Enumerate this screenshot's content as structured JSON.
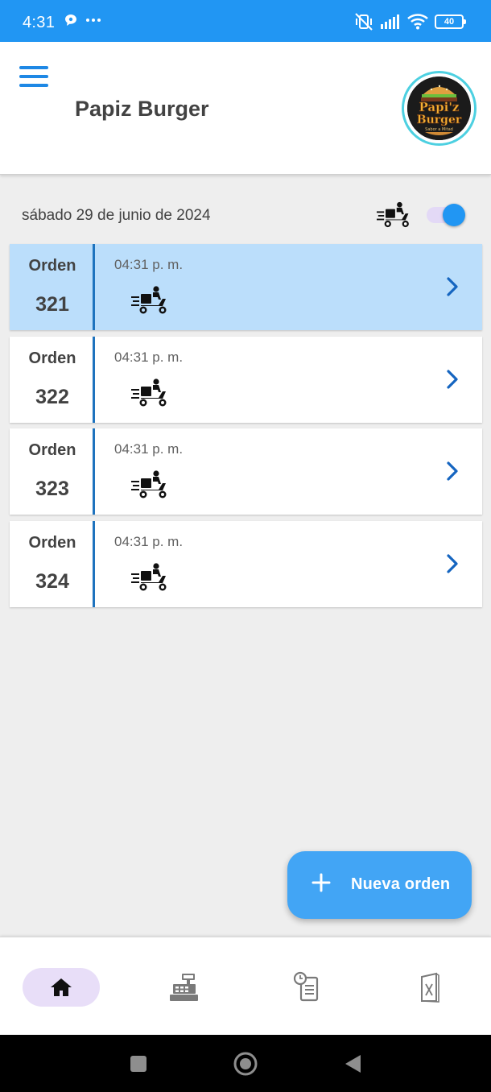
{
  "status_bar": {
    "time": "4:31",
    "battery": "40",
    "icons": [
      "chat-bubble-icon",
      "more-dots-icon",
      "vibrate-off-icon",
      "signal-icon",
      "wifi-icon",
      "battery-icon"
    ]
  },
  "header": {
    "title": "Papiz Burger",
    "logo": {
      "line1": "Papi'z",
      "line2": "Burger",
      "line3": "Sabor a Mitad"
    }
  },
  "date": "sábado 29 de junio de 2024",
  "delivery_toggle": {
    "on": true
  },
  "orders": [
    {
      "label": "Orden",
      "number": "321",
      "time": "04:31 p. m.",
      "selected": true,
      "icon": "delivery-scooter-icon"
    },
    {
      "label": "Orden",
      "number": "322",
      "time": "04:31 p. m.",
      "selected": false,
      "icon": "delivery-scooter-icon"
    },
    {
      "label": "Orden",
      "number": "323",
      "time": "04:31 p. m.",
      "selected": false,
      "icon": "delivery-scooter-icon"
    },
    {
      "label": "Orden",
      "number": "324",
      "time": "04:31 p. m.",
      "selected": false,
      "icon": "delivery-scooter-icon"
    }
  ],
  "fab": {
    "label": "Nueva orden",
    "icon": "plus-icon"
  },
  "bottom_nav": [
    {
      "icon": "home-icon",
      "active": true
    },
    {
      "icon": "cash-register-icon",
      "active": false
    },
    {
      "icon": "order-history-icon",
      "active": false
    },
    {
      "icon": "menu-card-icon",
      "active": false
    }
  ],
  "colors": {
    "status_bar": "#2196f3",
    "accent": "#1e88e5",
    "selected_card": "#bbdefb",
    "fab": "#42a5f5",
    "nav_active": "#e8def8",
    "logo_ring": "#4dd0e1"
  }
}
